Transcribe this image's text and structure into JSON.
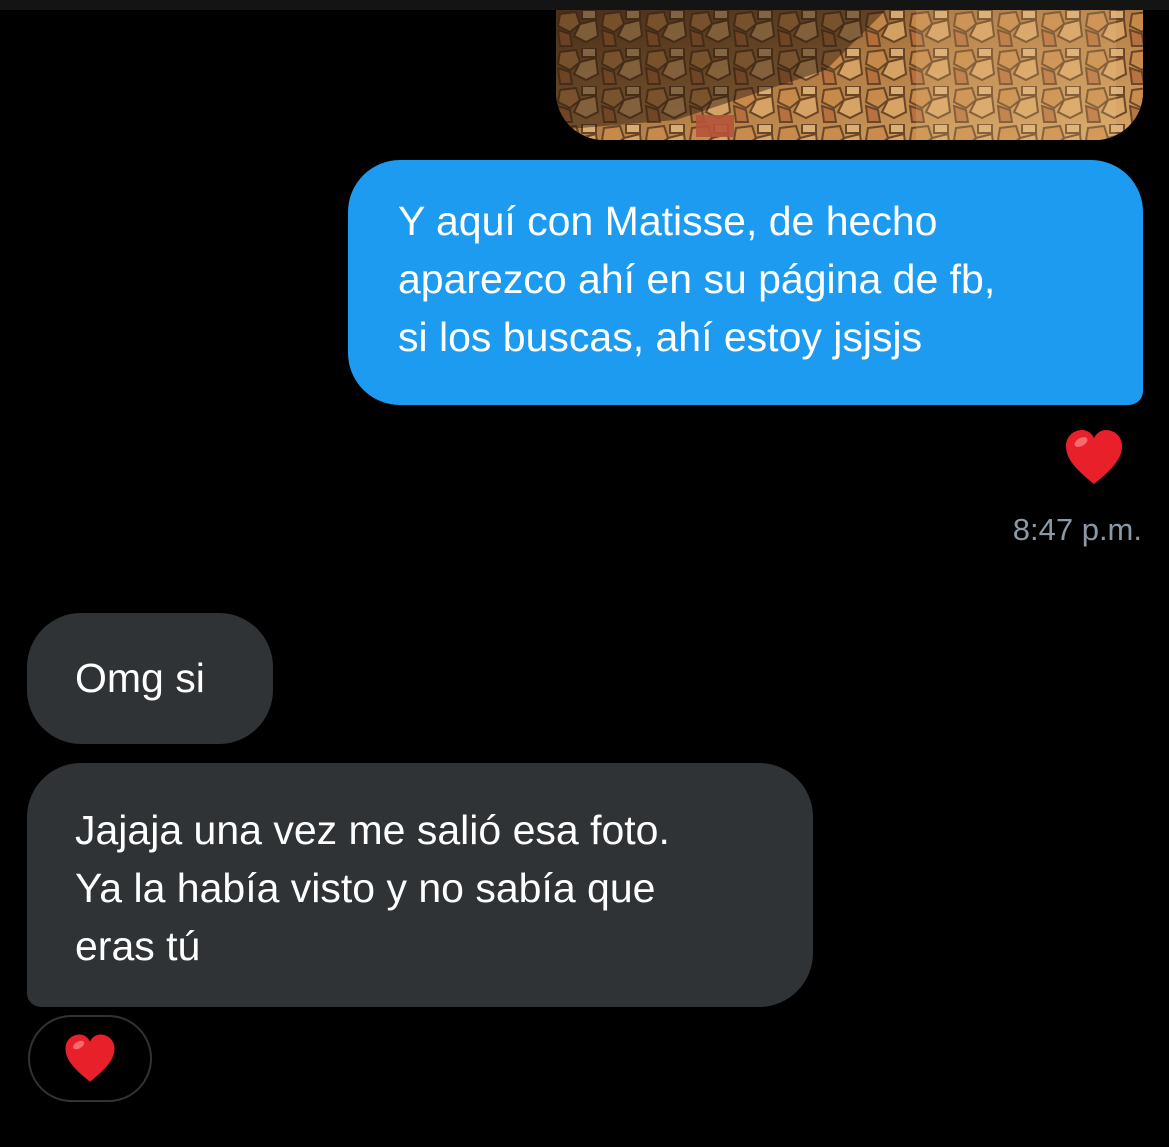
{
  "conversation": {
    "messages": [
      {
        "direction": "sent",
        "type": "image",
        "description_shown": ""
      },
      {
        "direction": "sent",
        "type": "text",
        "text": "Y aquí con Matisse, de hecho\naparezco ahí en su página de fb,\nsi los buscas, ahí estoy jsjsjs",
        "reaction_icon": "red-heart-icon",
        "timestamp": "8:47 p.m."
      },
      {
        "direction": "received",
        "type": "text",
        "text": "Omg si"
      },
      {
        "direction": "received",
        "type": "text",
        "text": "Jajaja una vez me salió esa foto.\nYa la había visto y no sabía que\neras tú",
        "reaction_icon": "red-heart-icon"
      }
    ]
  },
  "colors": {
    "background": "#000000",
    "sent_bubble": "#1d9bf0",
    "received_bubble": "#2f3336",
    "timestamp_text": "#8b98a5",
    "heart": "#e8202a"
  }
}
